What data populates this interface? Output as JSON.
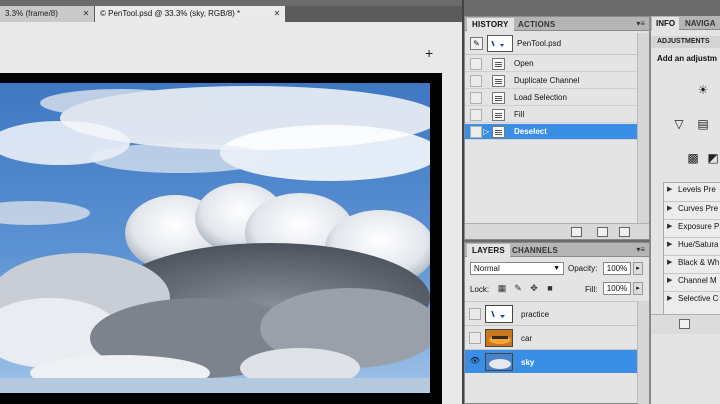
{
  "document": {
    "tabs": [
      {
        "label": "3.3% (frame/8)",
        "close": "✕"
      },
      {
        "label": "© PenTool.psd @ 33.3% (sky, RGB/8) *",
        "close": "✕"
      }
    ],
    "cursor_glyph": "+"
  },
  "history": {
    "tabs": [
      "HISTORY",
      "ACTIONS"
    ],
    "menu_glyph": "▾≡",
    "snapshot": {
      "label": "PenTool.psd"
    },
    "items": [
      {
        "label": "Open"
      },
      {
        "label": "Duplicate Channel"
      },
      {
        "label": "Load Selection"
      },
      {
        "label": "Fill"
      },
      {
        "label": "Deselect"
      }
    ],
    "selected_index": 4
  },
  "layers": {
    "tabs": [
      "LAYERS",
      "CHANNELS"
    ],
    "menu_glyph": "▾≡",
    "blend_mode": "Normal",
    "opacity_label": "Opacity:",
    "opacity_value": "100%",
    "lock_label": "Lock:",
    "fill_label": "Fill:",
    "fill_value": "100%",
    "items": [
      {
        "label": "practice"
      },
      {
        "label": "car"
      },
      {
        "label": "sky"
      }
    ],
    "selected_index": 2
  },
  "right_panel": {
    "tabs": [
      "INFO",
      "NAVIGA"
    ],
    "header": "ADJUSTMENTS",
    "subtitle": "Add an adjustm",
    "presets": [
      {
        "label": "Levels Pre"
      },
      {
        "label": "Curves Pre"
      },
      {
        "label": "Exposure P"
      },
      {
        "label": "Hue/Satura"
      },
      {
        "label": "Black & Wh"
      },
      {
        "label": "Channel M"
      },
      {
        "label": "Selective C"
      }
    ]
  },
  "colors": {
    "selection": "#3a8ee6",
    "panel_bg": "#e4e4e4",
    "tab_bar": "#b5b5b5"
  }
}
